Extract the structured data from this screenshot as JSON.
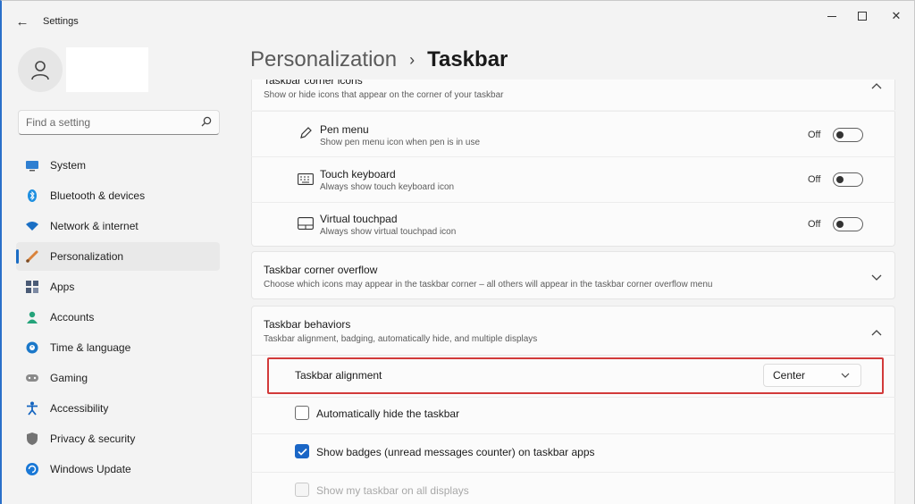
{
  "app": {
    "title": "Settings",
    "back": "←"
  },
  "window_controls": {
    "close": "✕"
  },
  "search": {
    "placeholder": "Find a setting"
  },
  "sidebar": {
    "items": [
      {
        "label": "System",
        "icon": "monitor-icon",
        "color": "#2f7fd1"
      },
      {
        "label": "Bluetooth & devices",
        "icon": "bluetooth-icon",
        "color": "#1e8fe0"
      },
      {
        "label": "Network & internet",
        "icon": "wifi-icon",
        "color": "#1a6fc4"
      },
      {
        "label": "Personalization",
        "icon": "brush-icon",
        "color": "#d9823b",
        "active": true
      },
      {
        "label": "Apps",
        "icon": "apps-icon",
        "color": "#4b5b76"
      },
      {
        "label": "Accounts",
        "icon": "person-icon",
        "color": "#24a37a"
      },
      {
        "label": "Time & language",
        "icon": "globe-clock-icon",
        "color": "#1b78c9"
      },
      {
        "label": "Gaming",
        "icon": "gamepad-icon",
        "color": "#7b7b7b"
      },
      {
        "label": "Accessibility",
        "icon": "accessibility-icon",
        "color": "#1565c0"
      },
      {
        "label": "Privacy & security",
        "icon": "shield-icon",
        "color": "#737373"
      },
      {
        "label": "Windows Update",
        "icon": "update-icon",
        "color": "#1a78d6"
      }
    ]
  },
  "breadcrumb": {
    "parent": "Personalization",
    "separator": "›",
    "current": "Taskbar"
  },
  "corner_icons": {
    "title": "Taskbar corner icons",
    "subtitle": "Show or hide icons that appear on the corner of your taskbar",
    "items": [
      {
        "title": "Pen menu",
        "subtitle": "Show pen menu icon when pen is in use",
        "state": "Off",
        "icon": "pen-icon"
      },
      {
        "title": "Touch keyboard",
        "subtitle": "Always show touch keyboard icon",
        "state": "Off",
        "icon": "keyboard-icon"
      },
      {
        "title": "Virtual touchpad",
        "subtitle": "Always show virtual touchpad icon",
        "state": "Off",
        "icon": "touchpad-icon"
      }
    ]
  },
  "corner_overflow": {
    "title": "Taskbar corner overflow",
    "subtitle": "Choose which icons may appear in the taskbar corner – all others will appear in the taskbar corner overflow menu"
  },
  "behaviors": {
    "title": "Taskbar behaviors",
    "subtitle": "Taskbar alignment, badging, automatically hide, and multiple displays",
    "alignment_label": "Taskbar alignment",
    "alignment_value": "Center",
    "options": [
      {
        "label": "Automatically hide the taskbar",
        "checked": false,
        "disabled": false
      },
      {
        "label": "Show badges (unread messages counter) on taskbar apps",
        "checked": true,
        "disabled": false
      },
      {
        "label": "Show my taskbar on all displays",
        "checked": false,
        "disabled": true
      }
    ]
  },
  "colors": {
    "accent": "#1a66c6",
    "highlight": "#d23a3a"
  }
}
